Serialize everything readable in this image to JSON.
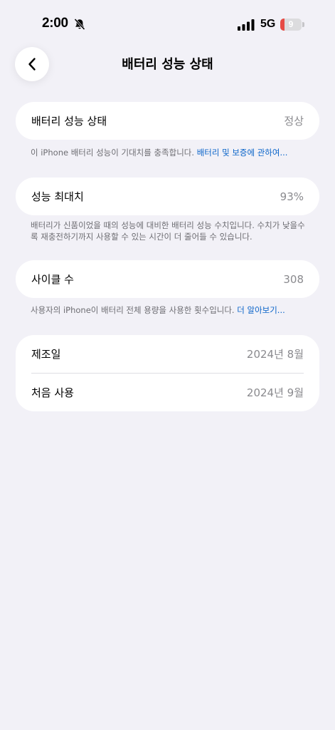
{
  "status_bar": {
    "time": "2:00",
    "network": "5G",
    "battery_level": "9",
    "battery_fraction": 0.09,
    "battery_color": "#e64b45"
  },
  "header": {
    "title": "배터리 성능 상태"
  },
  "health": {
    "label": "배터리 성능 상태",
    "value": "정상",
    "note_text": "이 iPhone 배터리 성능이 기대치를 충족합니다. ",
    "note_link": "배터리 및 보증에 관하여..."
  },
  "max_capacity": {
    "label": "성능 최대치",
    "value": "93%",
    "note_text": "배터리가 신품이었을 때의 성능에 대비한 배터리 성능 수치입니다. 수치가 낮을수록 재충전하기까지 사용할 수 있는 시간이 더 줄어들 수 있습니다."
  },
  "cycle_count": {
    "label": "사이클 수",
    "value": "308",
    "note_text": "사용자의 iPhone이 배터리 전체 용량을 사용한 횟수입니다. ",
    "note_link": "더 알아보기..."
  },
  "dates": {
    "manufacture_label": "제조일",
    "manufacture_value": "2024년 8월",
    "first_use_label": "처음 사용",
    "first_use_value": "2024년 9월"
  },
  "colors": {
    "background": "#f2f1f7",
    "link": "#0a64c9"
  }
}
